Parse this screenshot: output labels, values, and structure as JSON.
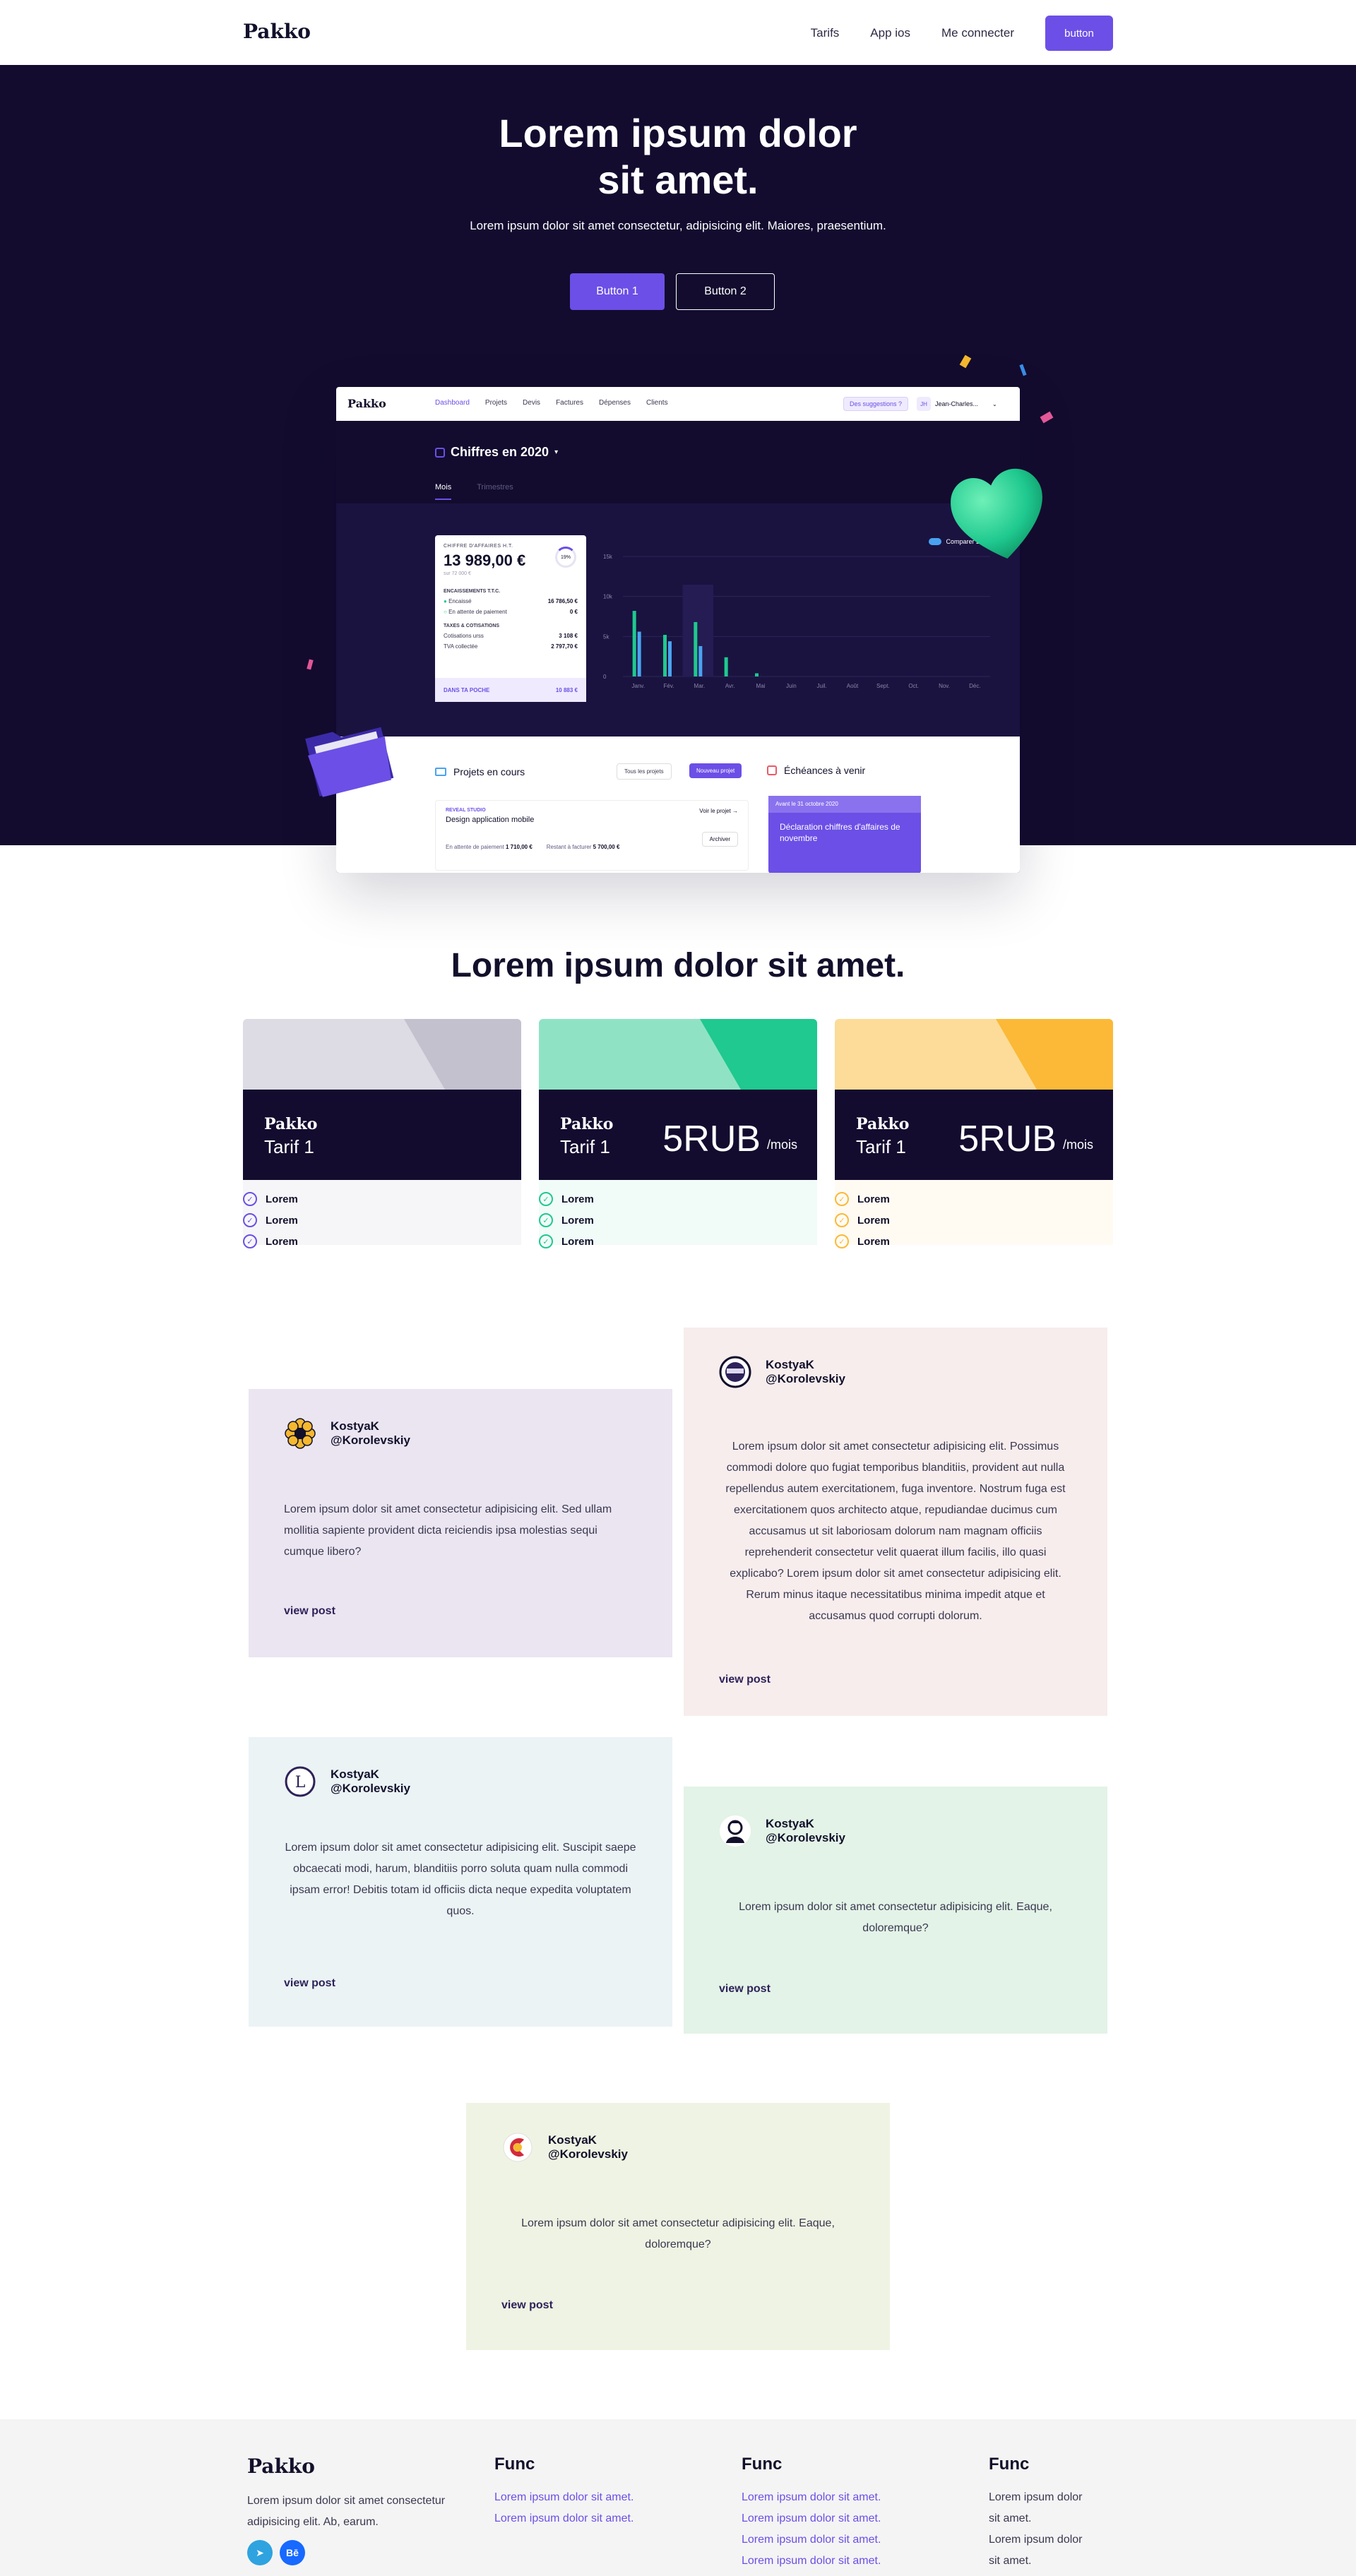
{
  "nav": {
    "logo": "Pakko",
    "links": [
      "Tarifs",
      "App ios",
      "Me connecter"
    ],
    "button": "button"
  },
  "hero": {
    "title_line1": "Lorem ipsum dolor",
    "title_line2": "sit amet.",
    "subtitle": "Lorem ipsum dolor sit amet consectetur, adipisicing elit. Maiores, praesentium.",
    "button1": "Button 1",
    "button2": "Button 2"
  },
  "app": {
    "logo": "Pakko",
    "nav": [
      "Dashboard",
      "Projets",
      "Devis",
      "Factures",
      "Dépenses",
      "Clients"
    ],
    "suggestions": "Des suggestions ?",
    "user_initials": "JH",
    "user_name": "Jean-Charles...",
    "year_title": "Chiffres en 2020",
    "tabs": [
      "Mois",
      "Trimestres"
    ],
    "kpi": {
      "label": "CHIFFRE D'AFFAIRES H.T.",
      "value": "13 989,00 €",
      "sub": "sur 72 000 €",
      "ring": "19%",
      "enc_title": "ENCAISSEMENTS T.T.C.",
      "enc_rows": [
        {
          "label": "Encaissé",
          "value": "16 786,50 €"
        },
        {
          "label": "En attente de paiement",
          "value": "0 €"
        }
      ],
      "tax_title": "TAXES & COTISATIONS",
      "tax_rows": [
        {
          "label": "Cotisations urss",
          "value": "3 108 €"
        },
        {
          "label": "TVA collectée",
          "value": "2 797,70 €"
        }
      ],
      "footer_label": "DANS TA POCHE",
      "footer_value": "10 883 €"
    },
    "compare_label": "Comparer 2019",
    "projects_title": "Projets en cours",
    "all_projects": "Tous les projets",
    "new_project": "Nouveau projet",
    "project": {
      "tag": "REVEAL STUDIO",
      "name": "Design application mobile",
      "see": "Voir le projet",
      "archive": "Archiver",
      "pending_label": "En attente de paiement",
      "pending_value": "1 710,00 €",
      "rest_label": "Restant à facturer",
      "rest_value": "5 700,00 €"
    },
    "deadlines_title": "Échéances à venir",
    "deadline": {
      "date": "Avant le 31 octobre 2020",
      "title": "Déclaration chiffres d'affaires de novembre"
    }
  },
  "chart_data": {
    "type": "bar",
    "categories": [
      "Janv.",
      "Fév.",
      "Mar.",
      "Avr.",
      "Mai",
      "Juin",
      "Juil.",
      "Août",
      "Sept.",
      "Oct.",
      "Nov.",
      "Déc."
    ],
    "y_ticks": [
      "15k",
      "10k",
      "5k",
      "0"
    ],
    "ylim": [
      0,
      15000
    ],
    "series": [
      {
        "name": "2020",
        "values": [
          8200,
          5200,
          6800,
          2400,
          400,
          0,
          0,
          0,
          0,
          0,
          0,
          0
        ]
      },
      {
        "name": "Comparer 2019",
        "values": [
          5600,
          4400,
          3800,
          0,
          0,
          0,
          0,
          0,
          0,
          0,
          0,
          0
        ]
      }
    ],
    "colors": {
      "2020": "#1fc98f",
      "2019": "#4aa3f0"
    }
  },
  "pricing": {
    "title": "Lorem ipsum dolor sit amet.",
    "cards": [
      {
        "logo": "Pakko",
        "tariff": "Tarif 1",
        "price": "",
        "per": "",
        "features": [
          "Lorem",
          "Lorem",
          "Lorem"
        ],
        "light": "#dddbe3",
        "accent": "#c4c1cf",
        "bg": "#f6f6f8",
        "check": "#6c4fe6"
      },
      {
        "logo": "Pakko",
        "tariff": "Tarif 1",
        "price": "5RUB",
        "per": "/mois",
        "features": [
          "Lorem",
          "Lorem",
          "Lorem"
        ],
        "light": "#8fe3c4",
        "accent": "#1fc98f",
        "bg": "#f1fbf7",
        "check": "#1fc98f"
      },
      {
        "logo": "Pakko",
        "tariff": "Tarif 1",
        "price": "5RUB",
        "per": "/mois",
        "features": [
          "Lorem",
          "Lorem",
          "Lorem"
        ],
        "light": "#fcdc98",
        "accent": "#fbb937",
        "bg": "#fffbf3",
        "check": "#fbb937"
      }
    ]
  },
  "testimonials": [
    {
      "name": "KostyaK",
      "handle": "@Korolevskiy",
      "text": "Lorem ipsum dolor sit amet consectetur adipisicing elit. Sed ullam mollitia sapiente provident dicta reiciendis ipsa molestias sequi cumque libero?",
      "link": "view post",
      "bg": "#ebe5f1"
    },
    {
      "name": "KostyaK",
      "handle": "@Korolevskiy",
      "text": "Lorem ipsum dolor sit amet consectetur adipisicing elit. Possimus commodi dolore quo fugiat temporibus blanditiis, provident aut nulla repellendus autem exercitationem, fuga inventore. Nostrum fuga est exercitationem quos architecto atque, repudiandae ducimus cum accusamus ut sit laboriosam dolorum nam magnam officiis reprehenderit consectetur velit quaerat illum facilis, illo quasi explicabo? Lorem ipsum dolor sit amet consectetur adipisicing elit. Rerum minus itaque necessitatibus minima impedit atque et accusamus quod corrupti dolorum.",
      "link": "view post",
      "bg": "#f7eded"
    },
    {
      "name": "KostyaK",
      "handle": "@Korolevskiy",
      "text": "Lorem ipsum dolor sit amet consectetur adipisicing elit. Suscipit saepe obcaecati modi, harum, blanditiis porro soluta quam nulla commodi ipsam error! Debitis totam id officiis dicta neque expedita voluptatem quos.",
      "link": "view post",
      "bg": "#ebf3f5"
    },
    {
      "name": "KostyaK",
      "handle": "@Korolevskiy",
      "text": "Lorem ipsum dolor sit amet consectetur adipisicing elit. Eaque, doloremque?",
      "link": "view post",
      "bg": "#e3f3e7"
    },
    {
      "name": "KostyaK",
      "handle": "@Korolevskiy",
      "text": "Lorem ipsum dolor sit amet consectetur adipisicing elit. Eaque, doloremque?",
      "link": "view post",
      "bg": "#eff3e3"
    }
  ],
  "footer": {
    "logo": "Pakko",
    "about": "Lorem ipsum dolor sit amet consectetur adipisicing elit. Ab, earum.",
    "columns": [
      {
        "title": "Func",
        "links": [
          "Lorem ipsum dolor sit amet.",
          "Lorem ipsum dolor sit amet."
        ]
      },
      {
        "title": "Func",
        "links": [
          "Lorem ipsum dolor sit amet.",
          "Lorem ipsum dolor sit amet.",
          "Lorem ipsum dolor sit amet.",
          "Lorem ipsum dolor sit amet."
        ]
      },
      {
        "title": "Func",
        "links": [
          "Lorem ipsum dolor sit amet.",
          "Lorem ipsum dolor sit amet."
        ]
      }
    ],
    "social": [
      "telegram-icon",
      "behance-icon"
    ]
  }
}
